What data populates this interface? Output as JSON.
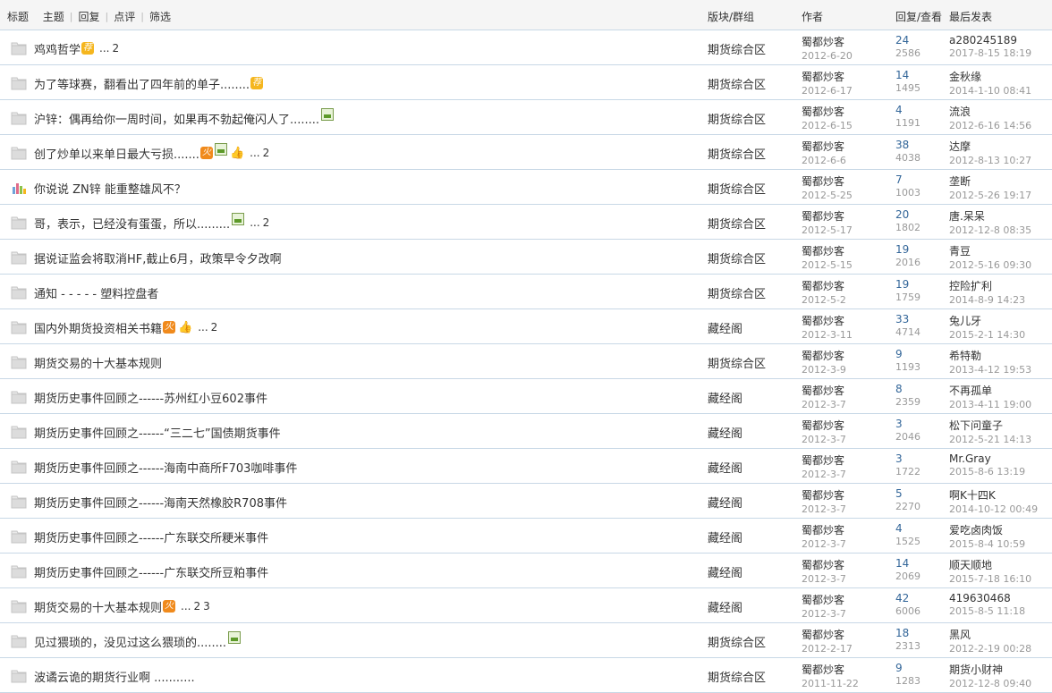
{
  "header": {
    "tabs": [
      "标题",
      "主题",
      "回复",
      "点评",
      "筛选"
    ],
    "col_forum": "版块/群组",
    "col_author": "作者",
    "col_stats": "回复/查看",
    "col_last": "最后发表"
  },
  "icons": {
    "folder": "folder-icon",
    "poll": "poll-icon",
    "image": "image-attachment-icon",
    "thumb": "thumbs-up-icon"
  },
  "colors": {
    "border": "#c8d8e6",
    "reply_count": "#336699",
    "muted": "#999999",
    "hot_badge": "#f08a1c",
    "recommend_badge": "#f5b61e"
  },
  "rows": [
    {
      "icon": "folder",
      "title": "鸡鸡哲学",
      "badges": [
        "荐"
      ],
      "img": false,
      "thumb": false,
      "pages": [
        "2"
      ],
      "forum": "期货综合区",
      "author": "蜀都炒客",
      "date": "2012-6-20",
      "replies": "24",
      "views": "2586",
      "last_user": "a280245189",
      "last_time": "2017-8-15 18:19"
    },
    {
      "icon": "folder",
      "title": "为了等球赛，翻看出了四年前的单子........",
      "badges": [
        "荐"
      ],
      "img": false,
      "thumb": false,
      "pages": [],
      "forum": "期货综合区",
      "author": "蜀都炒客",
      "date": "2012-6-17",
      "replies": "14",
      "views": "1495",
      "last_user": "金秋缘",
      "last_time": "2014-1-10 08:41"
    },
    {
      "icon": "folder",
      "title": "沪锌：偶再给你一周时间，如果再不勃起俺闪人了........",
      "badges": [],
      "img": true,
      "thumb": false,
      "pages": [],
      "forum": "期货综合区",
      "author": "蜀都炒客",
      "date": "2012-6-15",
      "replies": "4",
      "views": "1191",
      "last_user": "流浪",
      "last_time": "2012-6-16 14:56"
    },
    {
      "icon": "folder",
      "title": "创了炒单以来单日最大亏损.......",
      "badges": [
        "火"
      ],
      "img": true,
      "thumb": true,
      "pages": [
        "2"
      ],
      "forum": "期货综合区",
      "author": "蜀都炒客",
      "date": "2012-6-6",
      "replies": "38",
      "views": "4038",
      "last_user": "达摩",
      "last_time": "2012-8-13 10:27"
    },
    {
      "icon": "poll",
      "title": "你说说 ZN锌 能重整雄风不？",
      "badges": [],
      "img": false,
      "thumb": false,
      "pages": [],
      "forum": "期货综合区",
      "author": "蜀都炒客",
      "date": "2012-5-25",
      "replies": "7",
      "views": "1003",
      "last_user": "垄断",
      "last_time": "2012-5-26 19:17"
    },
    {
      "icon": "folder",
      "title": "哥，表示，已经没有蛋蛋，所以.........",
      "badges": [],
      "img": true,
      "thumb": false,
      "pages": [
        "2"
      ],
      "forum": "期货综合区",
      "author": "蜀都炒客",
      "date": "2012-5-17",
      "replies": "20",
      "views": "1802",
      "last_user": "唐.呆呆",
      "last_time": "2012-12-8 08:35"
    },
    {
      "icon": "folder",
      "title": "据说证监会将取消HF,截止6月，政策早令夕改啊",
      "badges": [],
      "img": false,
      "thumb": false,
      "pages": [],
      "forum": "期货综合区",
      "author": "蜀都炒客",
      "date": "2012-5-15",
      "replies": "19",
      "views": "2016",
      "last_user": "青豆",
      "last_time": "2012-5-16 09:30"
    },
    {
      "icon": "folder",
      "title": "通知 - - - - - 塑料控盘者",
      "badges": [],
      "img": false,
      "thumb": false,
      "pages": [],
      "forum": "期货综合区",
      "author": "蜀都炒客",
      "date": "2012-5-2",
      "replies": "19",
      "views": "1759",
      "last_user": "控险扩利",
      "last_time": "2014-8-9 14:23"
    },
    {
      "icon": "folder",
      "title": "国内外期货投资相关书籍",
      "badges": [
        "火"
      ],
      "img": false,
      "thumb": true,
      "pages": [
        "2"
      ],
      "forum": "藏经阁",
      "author": "蜀都炒客",
      "date": "2012-3-11",
      "replies": "33",
      "views": "4714",
      "last_user": "兔儿牙",
      "last_time": "2015-2-1 14:30"
    },
    {
      "icon": "folder",
      "title": "期货交易的十大基本规则",
      "badges": [],
      "img": false,
      "thumb": false,
      "pages": [],
      "forum": "期货综合区",
      "author": "蜀都炒客",
      "date": "2012-3-9",
      "replies": "9",
      "views": "1193",
      "last_user": "希特勒",
      "last_time": "2013-4-12 19:53"
    },
    {
      "icon": "folder",
      "title": "期货历史事件回顾之------苏州红小豆602事件",
      "badges": [],
      "img": false,
      "thumb": false,
      "pages": [],
      "forum": "藏经阁",
      "author": "蜀都炒客",
      "date": "2012-3-7",
      "replies": "8",
      "views": "2359",
      "last_user": "不再孤单",
      "last_time": "2013-4-11 19:00"
    },
    {
      "icon": "folder",
      "title": "期货历史事件回顾之------“三二七”国债期货事件",
      "badges": [],
      "img": false,
      "thumb": false,
      "pages": [],
      "forum": "藏经阁",
      "author": "蜀都炒客",
      "date": "2012-3-7",
      "replies": "3",
      "views": "2046",
      "last_user": "松下问童子",
      "last_time": "2012-5-21 14:13"
    },
    {
      "icon": "folder",
      "title": "期货历史事件回顾之------海南中商所F703咖啡事件",
      "badges": [],
      "img": false,
      "thumb": false,
      "pages": [],
      "forum": "藏经阁",
      "author": "蜀都炒客",
      "date": "2012-3-7",
      "replies": "3",
      "views": "1722",
      "last_user": "Mr.Gray",
      "last_time": "2015-8-6 13:19"
    },
    {
      "icon": "folder",
      "title": "期货历史事件回顾之------海南天然橡胶R708事件",
      "badges": [],
      "img": false,
      "thumb": false,
      "pages": [],
      "forum": "藏经阁",
      "author": "蜀都炒客",
      "date": "2012-3-7",
      "replies": "5",
      "views": "2270",
      "last_user": "啊K十四K",
      "last_time": "2014-10-12 00:49"
    },
    {
      "icon": "folder",
      "title": "期货历史事件回顾之------广东联交所粳米事件",
      "badges": [],
      "img": false,
      "thumb": false,
      "pages": [],
      "forum": "藏经阁",
      "author": "蜀都炒客",
      "date": "2012-3-7",
      "replies": "4",
      "views": "1525",
      "last_user": "爱吃卤肉饭",
      "last_time": "2015-8-4 10:59"
    },
    {
      "icon": "folder",
      "title": "期货历史事件回顾之------广东联交所豆粕事件",
      "badges": [],
      "img": false,
      "thumb": false,
      "pages": [],
      "forum": "藏经阁",
      "author": "蜀都炒客",
      "date": "2012-3-7",
      "replies": "14",
      "views": "2069",
      "last_user": "顺天顺地",
      "last_time": "2015-7-18 16:10"
    },
    {
      "icon": "folder",
      "title": "期货交易的十大基本规则",
      "badges": [
        "火"
      ],
      "img": false,
      "thumb": false,
      "pages": [
        "2",
        "3"
      ],
      "forum": "藏经阁",
      "author": "蜀都炒客",
      "date": "2012-3-7",
      "replies": "42",
      "views": "6006",
      "last_user": "419630468",
      "last_time": "2015-8-5 11:18"
    },
    {
      "icon": "folder",
      "title": "见过猥琐的，没见过这么猥琐的........",
      "badges": [],
      "img": true,
      "thumb": false,
      "pages": [],
      "forum": "期货综合区",
      "author": "蜀都炒客",
      "date": "2012-2-17",
      "replies": "18",
      "views": "2313",
      "last_user": "黑风",
      "last_time": "2012-2-19 00:28"
    },
    {
      "icon": "folder",
      "title": "波谲云诡的期货行业啊 ...........",
      "badges": [],
      "img": false,
      "thumb": false,
      "pages": [],
      "forum": "期货综合区",
      "author": "蜀都炒客",
      "date": "2011-11-22",
      "replies": "9",
      "views": "1283",
      "last_user": "期货小财神",
      "last_time": "2012-12-8 09:40"
    }
  ]
}
